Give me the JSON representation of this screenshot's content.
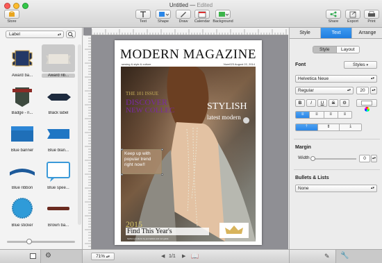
{
  "window": {
    "title": "Untitled",
    "status": "Edited"
  },
  "toolbar": {
    "store": "Store",
    "text": "Text",
    "shape": "Shape",
    "draw": "Draw",
    "calendar": "Calendar",
    "background": "Background",
    "share": "Share",
    "export": "Export",
    "print": "Print"
  },
  "library": {
    "category": "Label",
    "items": [
      {
        "label": "Award ba..."
      },
      {
        "label": "Award rib..."
      },
      {
        "label": "Badge - ri..."
      },
      {
        "label": "Black label"
      },
      {
        "label": "Blue banner"
      },
      {
        "label": "Blue blan..."
      },
      {
        "label": "Blue ribbon"
      },
      {
        "label": "Blue spee..."
      },
      {
        "label": "Blue sticker"
      },
      {
        "label": "Brown ba..."
      }
    ]
  },
  "magazine": {
    "title": "MODERN MAGAZINE",
    "subtitle": "sewing & style & culture",
    "issue_date": "Num023 August 22, 2014",
    "the_issue": "THE 101 ISSUE",
    "discover": "DISCOVER",
    "new_collection": "NEW COLLEC",
    "stylish": "STYLISH",
    "latest_modern": "latest modern",
    "keep_up": "Keep up with popular trend right now!!",
    "year": "2015",
    "find": "Find This Year's",
    "fine_print": "fashion products by journalists and our guide"
  },
  "inspector": {
    "tabs": [
      "Style",
      "Text",
      "Arrange"
    ],
    "subtabs": [
      "Style",
      "Layout"
    ],
    "font_label": "Font",
    "styles_btn": "Styles",
    "font_family": "Helvetica Neue",
    "font_weight": "Regular",
    "font_size": "20",
    "bold": "B",
    "italic": "I",
    "underline": "U",
    "strike": "S",
    "margin_label": "Margin",
    "width_label": "Width",
    "margin_width": "0",
    "bullets_label": "Bullets & Lists",
    "bullets_value": "None"
  },
  "statusbar": {
    "zoom": "71%",
    "page": "1/1"
  },
  "colors": {
    "accent": "#2a86e8",
    "magazine_title": "#111111",
    "gold": "#c9b15c",
    "purple": "#7a2aa0"
  }
}
